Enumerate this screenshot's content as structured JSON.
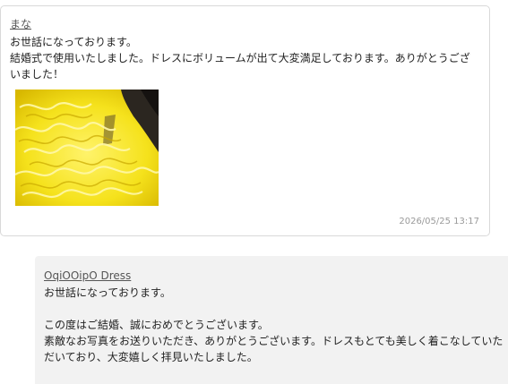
{
  "review": {
    "author": "まな",
    "greeting": "お世話になっております。",
    "line1": "結婚式で使用いたしました。ドレスにボリュームが出て大変満足しております。ありがとうござ",
    "line2": "いました！",
    "photo_icon": "yellow-ruffle-dress-photo",
    "timestamp": "2026/05/25 13:17"
  },
  "reply": {
    "author": "OqiOOipO Dress",
    "greeting": "お世話になっております。",
    "line1": "この度はご結婚、誠におめでとうございます。",
    "line2": "素敵なお写真をお送りいただき、ありがとうございます。ドレスもとても美しく着こなしていた",
    "line3": "だいており、大変嬉しく拝見いたしました。"
  },
  "colors": {
    "card_border": "#d9d9d9",
    "reply_background": "#f2f2f2",
    "timestamp": "#9a9a9a",
    "dress_yellow": "#f5e21c"
  }
}
